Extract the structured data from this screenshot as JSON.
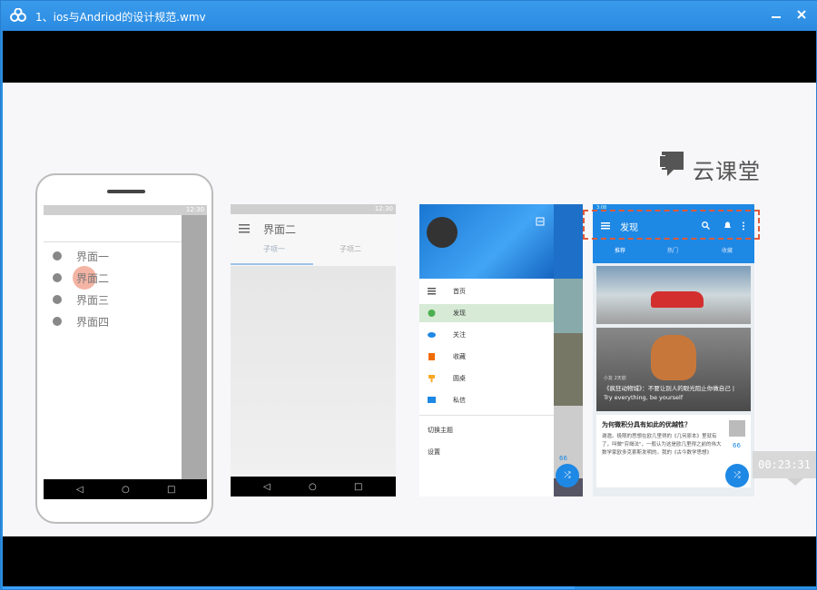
{
  "window": {
    "title": "1、ios与Andriod的设计规范.wmv",
    "buttons": [
      "minimize",
      "maximize",
      "close"
    ]
  },
  "slide": {
    "logo_text": "云课堂",
    "timestamp": "00:23:31",
    "phone1": {
      "status_time": "12:30",
      "items": [
        "界面一",
        "界面二",
        "界面三",
        "界面四"
      ]
    },
    "screen2": {
      "status_time": "12:30",
      "title": "界面二",
      "tabs": [
        "子项一",
        "子项二"
      ]
    },
    "screen3": {
      "drawer_items": [
        "首页",
        "发现",
        "关注",
        "收藏",
        "圆桌",
        "私信"
      ],
      "footer_items": [
        "切换主题",
        "设置"
      ],
      "badge": "66"
    },
    "screen4": {
      "status_time": "3:08",
      "title": "发现",
      "tabs": [
        "推荐",
        "热门",
        "收藏"
      ],
      "card2_meta": "小友 2天前",
      "card2_title": "《疯狂动物城》：不要让别人的眼光阻止你做自己 | Try everything, be yourself",
      "card3_title": "为何微积分具有如此的优越性？",
      "card3_text": "谢邀。极限的思想在欧几里得的《几何原本》里就有了，叫做\"穷竭法\"，一般认为这是欧几里得之前的伟大数学家欧多克索斯发明的。我的《古今数学思想》",
      "badge": "66"
    }
  },
  "colors": {
    "titlebar": "#2a8ae0",
    "accent": "#1e88e5",
    "dash": "#e05a3a",
    "progress": "#3aa0ff"
  }
}
